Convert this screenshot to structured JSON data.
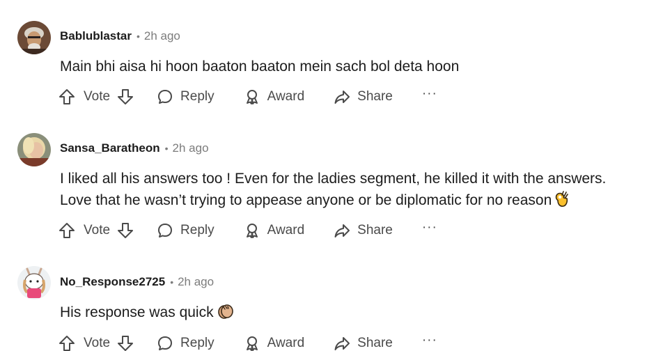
{
  "comments": [
    {
      "username": "Bablublastar",
      "separator": "•",
      "time": "2h ago",
      "text": "Main bhi aisa hi hoon baaton baaton mein sach bol deta hoon",
      "emoji": "",
      "actions": {
        "vote": "Vote",
        "reply": "Reply",
        "award": "Award",
        "share": "Share",
        "more": "···"
      }
    },
    {
      "username": "Sansa_Baratheon",
      "separator": "•",
      "time": "2h ago",
      "text": "I liked all his answers too ! Even for the ladies segment, he killed it with the answers. Love that he wasn’t trying to appease anyone or be diplomatic for no reason",
      "emoji": "ok-hand-emoji",
      "actions": {
        "vote": "Vote",
        "reply": "Reply",
        "award": "Award",
        "share": "Share",
        "more": "···"
      }
    },
    {
      "username": "No_Response2725",
      "separator": "•",
      "time": "2h ago",
      "text": "His response was quick",
      "emoji": "clapping-hands-emoji",
      "actions": {
        "vote": "Vote",
        "reply": "Reply",
        "award": "Award",
        "share": "Share",
        "more": "···"
      }
    }
  ],
  "icons": {
    "upvote": "upvote-arrow-icon",
    "downvote": "downvote-arrow-icon",
    "reply": "speech-bubble-icon",
    "award": "award-ribbon-icon",
    "share": "share-arrow-icon",
    "more": "more-options-icon"
  },
  "colors": {
    "text": "#1c1c1c",
    "meta": "#7c7c7c",
    "action": "#4a4a4a",
    "background": "#ffffff"
  }
}
